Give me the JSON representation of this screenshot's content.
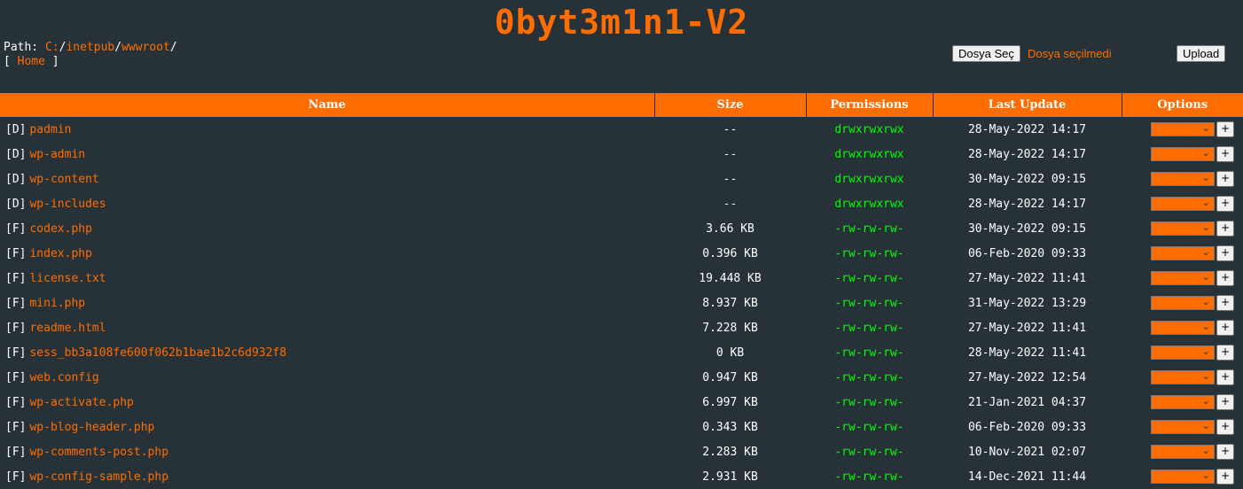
{
  "title": "0byt3m1n1-V2",
  "path": {
    "label": "Path:",
    "segments": [
      "C:",
      "inetpub",
      "wwwroot"
    ],
    "separator": "/"
  },
  "home": {
    "open": "[",
    "label": "Home",
    "close": "]"
  },
  "upload": {
    "choose_label": "Dosya Seç",
    "no_file_label": "Dosya seçilmedi",
    "upload_label": "Upload"
  },
  "table": {
    "headers": [
      "Name",
      "Size",
      "Permissions",
      "Last Update",
      "Options"
    ],
    "rows": [
      {
        "type": "[D]",
        "name": "padmin",
        "size": "--",
        "perm": "drwxrwxrwx",
        "date": "28-May-2022 14:17"
      },
      {
        "type": "[D]",
        "name": "wp-admin",
        "size": "--",
        "perm": "drwxrwxrwx",
        "date": "28-May-2022 14:17"
      },
      {
        "type": "[D]",
        "name": "wp-content",
        "size": "--",
        "perm": "drwxrwxrwx",
        "date": "30-May-2022 09:15"
      },
      {
        "type": "[D]",
        "name": "wp-includes",
        "size": "--",
        "perm": "drwxrwxrwx",
        "date": "28-May-2022 14:17"
      },
      {
        "type": "[F]",
        "name": "codex.php",
        "size": "3.66 KB",
        "perm": "-rw-rw-rw-",
        "date": "30-May-2022 09:15"
      },
      {
        "type": "[F]",
        "name": "index.php",
        "size": "0.396 KB",
        "perm": "-rw-rw-rw-",
        "date": "06-Feb-2020 09:33"
      },
      {
        "type": "[F]",
        "name": "license.txt",
        "size": "19.448 KB",
        "perm": "-rw-rw-rw-",
        "date": "27-May-2022 11:41"
      },
      {
        "type": "[F]",
        "name": "mini.php",
        "size": "8.937 KB",
        "perm": "-rw-rw-rw-",
        "date": "31-May-2022 13:29"
      },
      {
        "type": "[F]",
        "name": "readme.html",
        "size": "7.228 KB",
        "perm": "-rw-rw-rw-",
        "date": "27-May-2022 11:41"
      },
      {
        "type": "[F]",
        "name": "sess_bb3a108fe600f062b1bae1b2c6d932f8",
        "size": "0 KB",
        "perm": "-rw-rw-rw-",
        "date": "28-May-2022 11:41"
      },
      {
        "type": "[F]",
        "name": "web.config",
        "size": "0.947 KB",
        "perm": "-rw-rw-rw-",
        "date": "27-May-2022 12:54"
      },
      {
        "type": "[F]",
        "name": "wp-activate.php",
        "size": "6.997 KB",
        "perm": "-rw-rw-rw-",
        "date": "21-Jan-2021 04:37"
      },
      {
        "type": "[F]",
        "name": "wp-blog-header.php",
        "size": "0.343 KB",
        "perm": "-rw-rw-rw-",
        "date": "06-Feb-2020 09:33"
      },
      {
        "type": "[F]",
        "name": "wp-comments-post.php",
        "size": "2.283 KB",
        "perm": "-rw-rw-rw-",
        "date": "10-Nov-2021 02:07"
      },
      {
        "type": "[F]",
        "name": "wp-config-sample.php",
        "size": "2.931 KB",
        "perm": "-rw-rw-rw-",
        "date": "14-Dec-2021 11:44"
      }
    ],
    "option_button": "+"
  },
  "colors": {
    "background": "#263238",
    "accent": "#ff6d00",
    "permission": "#00ff00"
  }
}
